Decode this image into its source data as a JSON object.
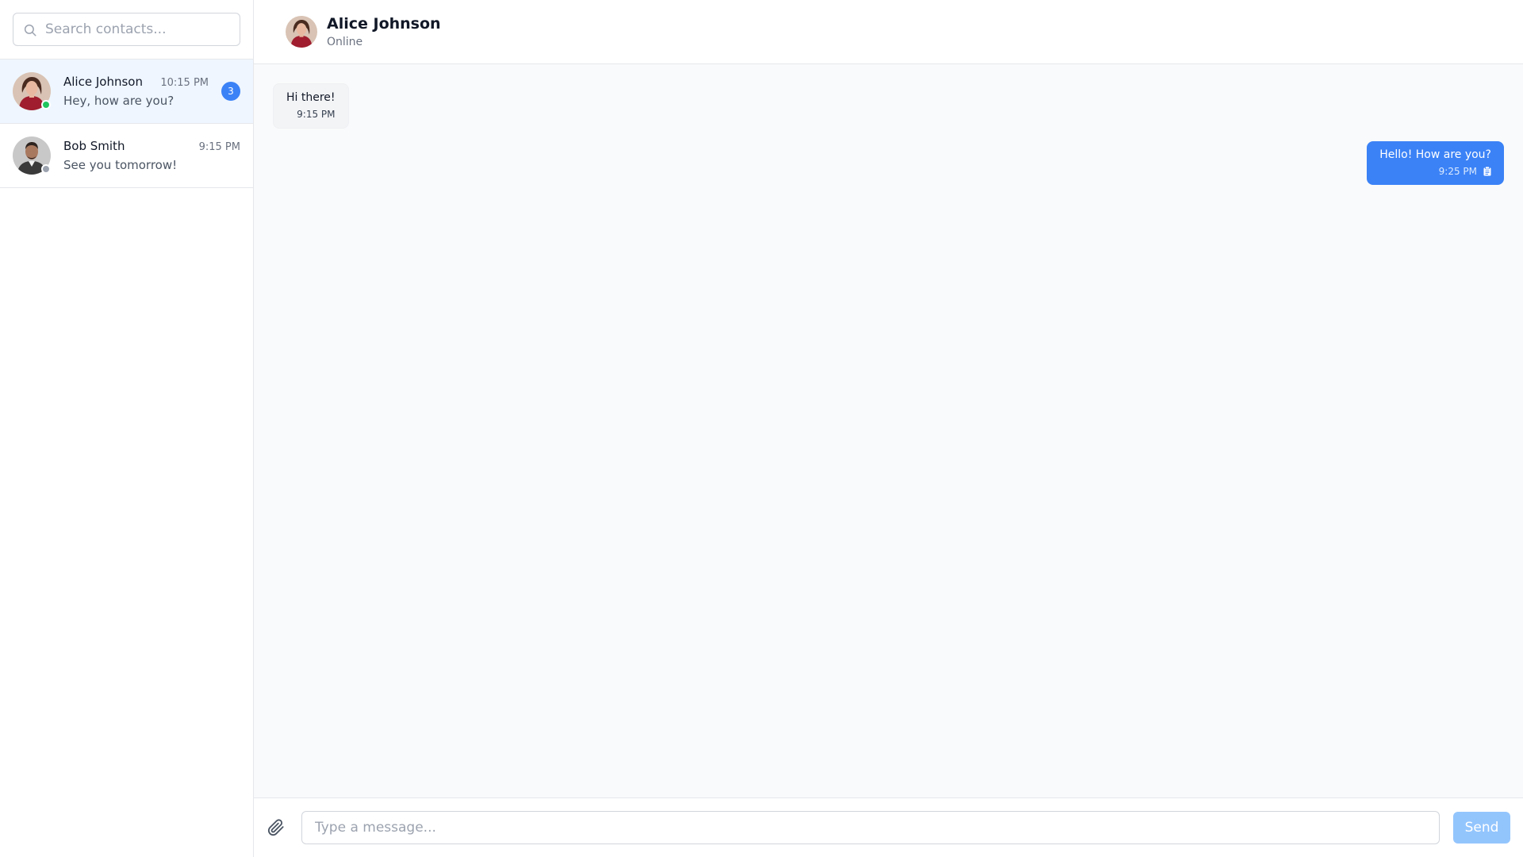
{
  "search": {
    "placeholder": "Search contacts..."
  },
  "contacts": [
    {
      "name": "Alice Johnson",
      "time": "10:15 PM",
      "preview": "Hey, how are you?",
      "unread": "3",
      "status_color": "#22c55e"
    },
    {
      "name": "Bob Smith",
      "time": "9:15 PM",
      "preview": "See you tomorrow!",
      "status_color": "#9ca3af"
    }
  ],
  "chat_header": {
    "name": "Alice Johnson",
    "status": "Online"
  },
  "messages": [
    {
      "text": "Hi there!",
      "time": "9:15 PM",
      "direction": "incoming"
    },
    {
      "text": "Hello! How are you?",
      "time": "9:25 PM",
      "direction": "outgoing",
      "status_icon": "clipboard-icon"
    }
  ],
  "composer": {
    "placeholder": "Type a message...",
    "send_label": "Send",
    "attach_icon": "paperclip-icon"
  },
  "colors": {
    "accent": "#3b82f6",
    "online": "#22c55e",
    "offline": "#9ca3af"
  }
}
